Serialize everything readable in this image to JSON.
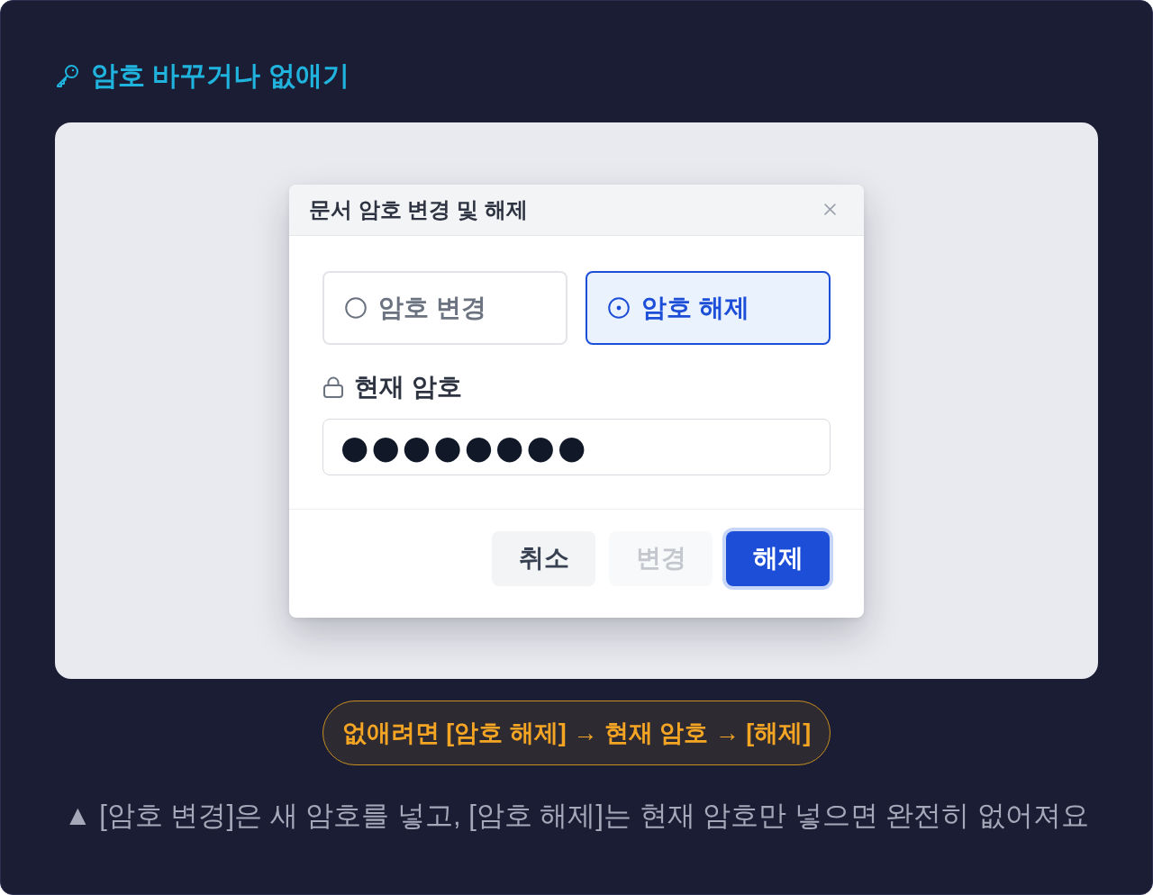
{
  "heading": {
    "text": "암호 바꾸거나 없애기"
  },
  "dialog": {
    "title": "문서 암호 변경 및 해제",
    "options": [
      {
        "label": "암호 변경",
        "selected": false
      },
      {
        "label": "암호 해제",
        "selected": true
      }
    ],
    "password": {
      "label": "현재 암호",
      "value": "●●●●●●●●"
    },
    "buttons": [
      {
        "label": "취소",
        "kind": "secondary",
        "disabled": false,
        "focused": false
      },
      {
        "label": "변경",
        "kind": "secondary",
        "disabled": true,
        "focused": false
      },
      {
        "label": "해제",
        "kind": "primary",
        "disabled": false,
        "focused": true
      }
    ]
  },
  "tip": {
    "text": "없애려면 [암호 해제] → 현재 암호 → [해제]"
  },
  "caption": {
    "text": "▲ [암호 변경]은 새 암호를 넣고, [암호 해제]는 현재 암호만 넣으면 완전히 없어져요"
  }
}
